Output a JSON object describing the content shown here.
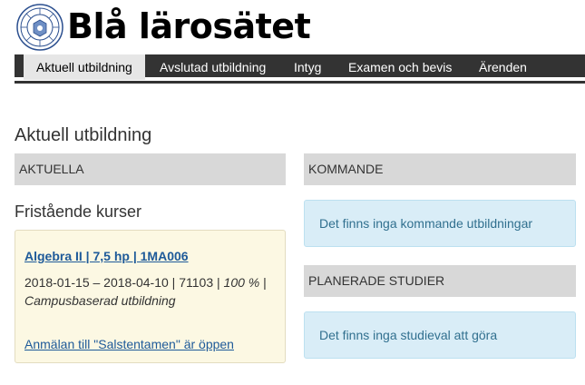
{
  "header": {
    "site_title": "Blå lärosätet",
    "logo_icon": "university-seal-icon"
  },
  "nav": {
    "items": [
      {
        "label": "Aktuell utbildning",
        "active": true
      },
      {
        "label": "Avslutad utbildning",
        "active": false
      },
      {
        "label": "Intyg",
        "active": false
      },
      {
        "label": "Examen och bevis",
        "active": false
      },
      {
        "label": "Ärenden",
        "active": false
      }
    ]
  },
  "main": {
    "heading": "Aktuell utbildning",
    "current": {
      "section_label": "AKTUELLA",
      "subheading": "Fristående kurser",
      "course": {
        "title": "Algebra II | 7,5 hp | 1MA006",
        "dates": "2018-01-15 – 2018-04-10",
        "code": "71103",
        "pace": "100 %",
        "form": "Campusbaserad utbildning",
        "notice": "Anmälan till \"Salstentamen\" är öppen"
      }
    },
    "upcoming": {
      "section_label": "KOMMANDE",
      "message": "Det finns inga kommande utbildningar"
    },
    "planned": {
      "section_label": "PLANERADE STUDIER",
      "message": "Det finns inga studieval att göra"
    }
  },
  "colors": {
    "nav_bg": "#333333",
    "nav_active_bg": "#e6e6e6",
    "section_bar_bg": "#d8d8d8",
    "info_bg": "#d9edf7",
    "info_text": "#31708f",
    "course_bg": "#fcf8e3",
    "link": "#1e5a99"
  }
}
